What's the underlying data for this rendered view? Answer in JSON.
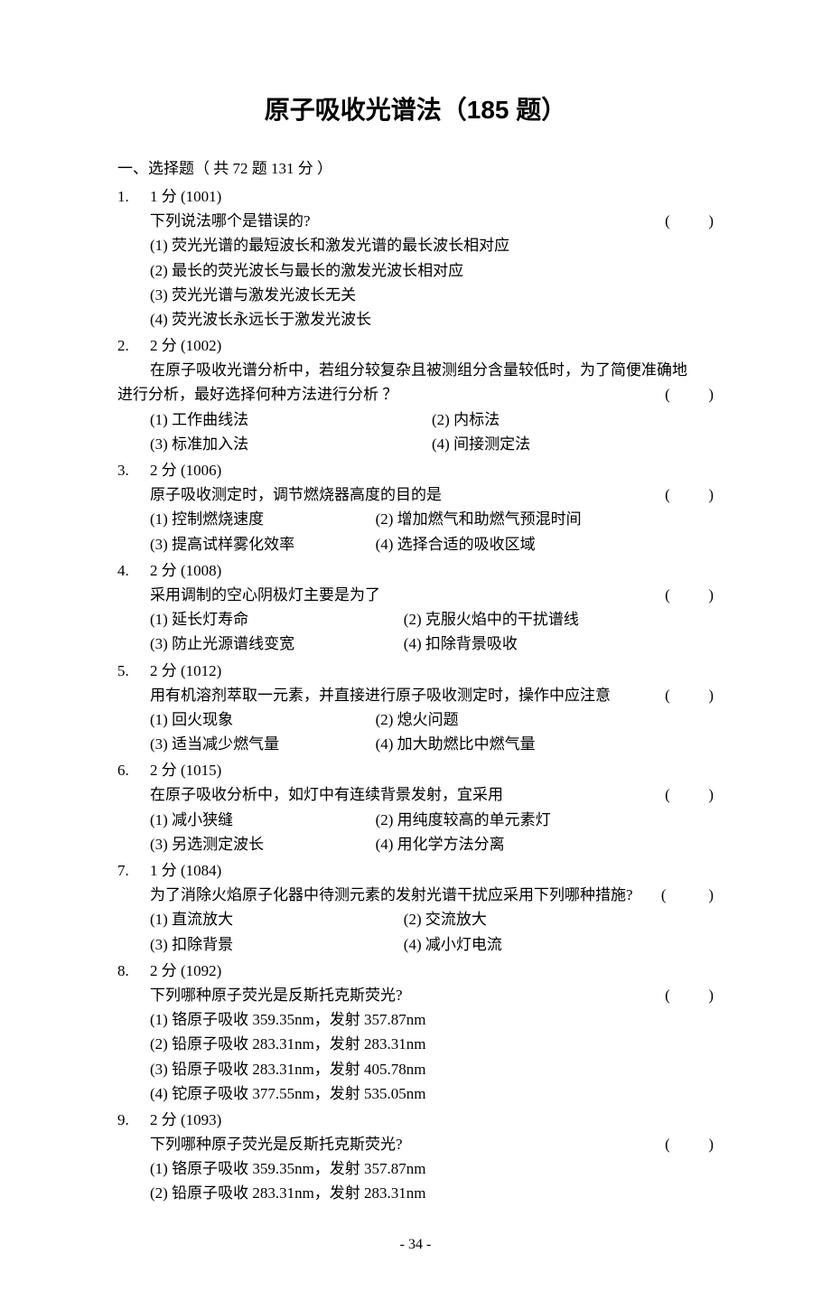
{
  "title": "原子吸收光谱法（185 题）",
  "section": "一、选择题（ 共 72 题   131 分 ）",
  "blank_paren": "(          )",
  "blank_paren_wide": " (           )",
  "footer": "- 34 -",
  "q1": {
    "num": "1.",
    "meta": "1 分 (1001)",
    "stem": "下列说法哪个是错误的?",
    "o1": "(1) 荧光光谱的最短波长和激发光谱的最长波长相对应",
    "o2": "(2) 最长的荧光波长与最长的激发光波长相对应",
    "o3": "(3) 荧光光谱与激发光波长无关",
    "o4": "(4) 荧光波长永远长于激发光波长"
  },
  "q2": {
    "num": "2.",
    "meta": "2 分 (1002)",
    "stem1": "在原子吸收光谱分析中，若组分较复杂且被测组分含量较低时，为了简便准确地",
    "stem2": "进行分析，最好选择何种方法进行分析 ？",
    "o1": "(1) 工作曲线法",
    "o2": "(2) 内标法",
    "o3": "(3) 标准加入法",
    "o4": "(4) 间接测定法"
  },
  "q3": {
    "num": "3.",
    "meta": "2 分 (1006)",
    "stem": "原子吸收测定时，调节燃烧器高度的目的是",
    "o1": "(1) 控制燃烧速度",
    "o2": "(2) 增加燃气和助燃气预混时间",
    "o3": "(3) 提高试样雾化效率",
    "o4": "(4) 选择合适的吸收区域"
  },
  "q4": {
    "num": "4.",
    "meta": "2 分 (1008)",
    "stem": "采用调制的空心阴极灯主要是为了",
    "o1": "(1) 延长灯寿命",
    "o2": "(2) 克服火焰中的干扰谱线",
    "o3": "(3) 防止光源谱线变宽",
    "o4": "(4) 扣除背景吸收"
  },
  "q5": {
    "num": "5.",
    "meta": "2 分 (1012)",
    "stem": "用有机溶剂萃取一元素，并直接进行原子吸收测定时，操作中应注意",
    "o1": "(1) 回火现象",
    "o2": "(2) 熄火问题",
    "o3": "(3) 适当减少燃气量",
    "o4": "(4) 加大助燃比中燃气量"
  },
  "q6": {
    "num": "6.",
    "meta": "2 分 (1015)",
    "stem": "在原子吸收分析中，如灯中有连续背景发射，宜采用",
    "o1": "(1) 减小狭缝",
    "o2": "(2) 用纯度较高的单元素灯",
    "o3": "(3) 另选测定波长",
    "o4": "(4) 用化学方法分离"
  },
  "q7": {
    "num": "7.",
    "meta": "1 分 (1084)",
    "stem": "为了消除火焰原子化器中待测元素的发射光谱干扰应采用下列哪种措施?",
    "o1": "(1) 直流放大",
    "o2": "(2) 交流放大",
    "o3": "(3) 扣除背景",
    "o4": "(4) 减小灯电流"
  },
  "q8": {
    "num": "8.",
    "meta": "2 分 (1092)",
    "stem": "下列哪种原子荧光是反斯托克斯荧光?",
    "o1": "(1) 铬原子吸收 359.35nm，发射 357.87nm",
    "o2": "(2) 铅原子吸收 283.31nm，发射 283.31nm",
    "o3": "(3) 铅原子吸收 283.31nm，发射 405.78nm",
    "o4": "(4) 铊原子吸收 377.55nm，发射 535.05nm"
  },
  "q9": {
    "num": "9.",
    "meta": "2 分 (1093)",
    "stem": "下列哪种原子荧光是反斯托克斯荧光?",
    "o1": "(1) 铬原子吸收 359.35nm，发射 357.87nm",
    "o2": "(2) 铅原子吸收 283.31nm，发射 283.31nm"
  }
}
